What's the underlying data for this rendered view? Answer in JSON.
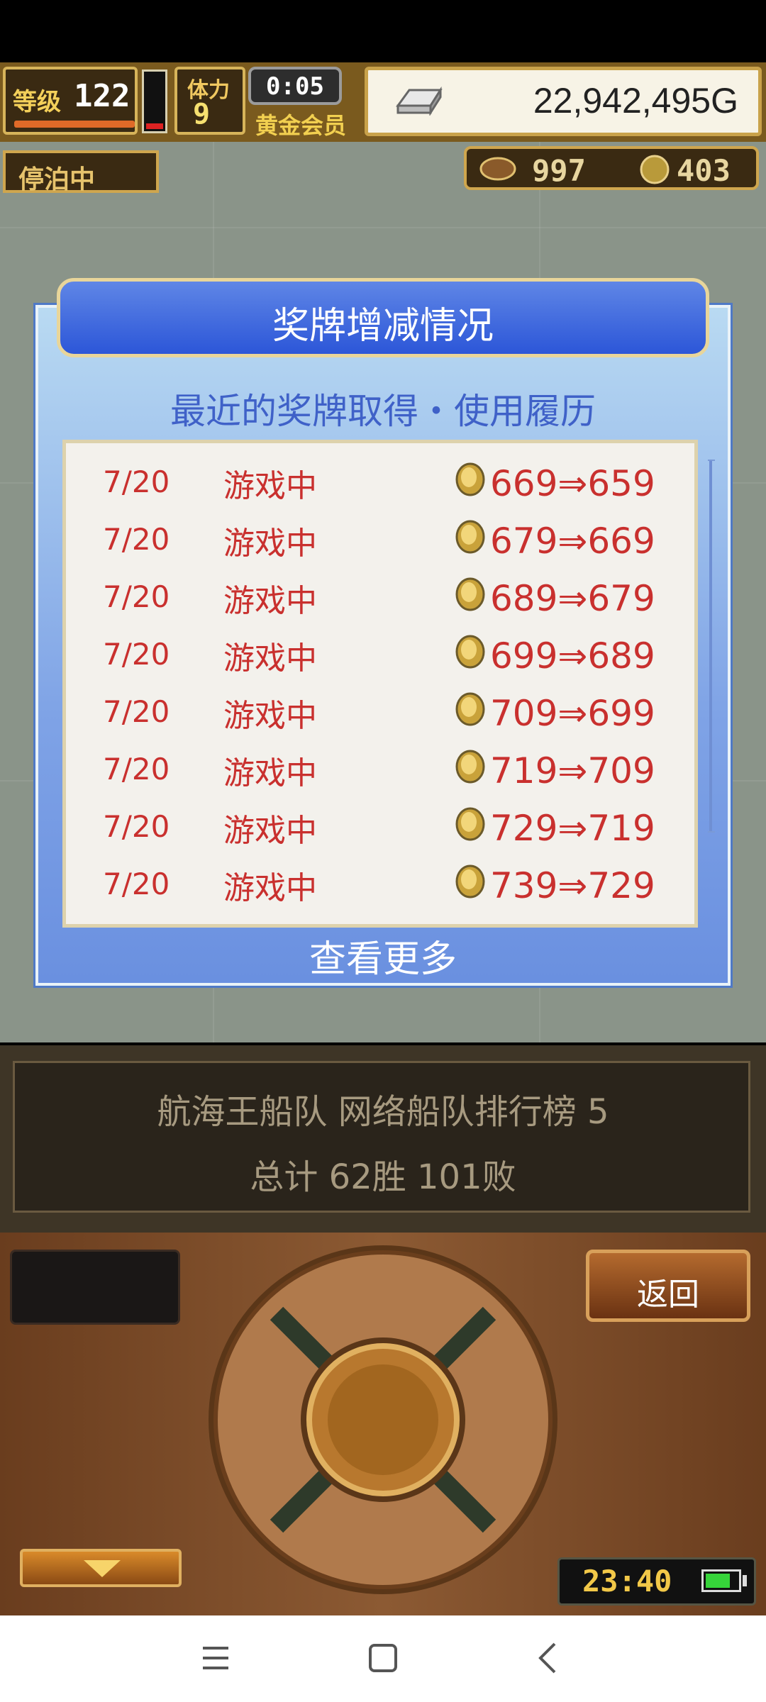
{
  "hud": {
    "level_label": "等级",
    "level": "122",
    "stamina_label": "体力",
    "stamina": "9",
    "timer": "0:05",
    "vip_label": "黄金会员",
    "gold": "22,942,495G",
    "moored_label": "停泊中",
    "resource1": "997",
    "resource2": "403"
  },
  "dialog": {
    "title": "奖牌增减情况",
    "subtitle": "最近的奖牌取得・使用履历",
    "rows": [
      {
        "date": "7/20",
        "desc": "游戏中",
        "change": "669⇒659"
      },
      {
        "date": "7/20",
        "desc": "游戏中",
        "change": "679⇒669"
      },
      {
        "date": "7/20",
        "desc": "游戏中",
        "change": "689⇒679"
      },
      {
        "date": "7/20",
        "desc": "游戏中",
        "change": "699⇒689"
      },
      {
        "date": "7/20",
        "desc": "游戏中",
        "change": "709⇒699"
      },
      {
        "date": "7/20",
        "desc": "游戏中",
        "change": "719⇒709"
      },
      {
        "date": "7/20",
        "desc": "游戏中",
        "change": "729⇒719"
      },
      {
        "date": "7/20",
        "desc": "游戏中",
        "change": "739⇒729"
      }
    ],
    "see_more": "查看更多"
  },
  "info": {
    "line1": "航海王船队  网络船队排行榜  5",
    "line2": "总计 62胜 101败"
  },
  "controls": {
    "back_label": "返回",
    "clock": "23:40",
    "down_icon": "chevron-down-icon"
  },
  "colors": {
    "accent_blue": "#2c56d8",
    "history_text": "#c9302e",
    "wood": "#8c5a33"
  }
}
